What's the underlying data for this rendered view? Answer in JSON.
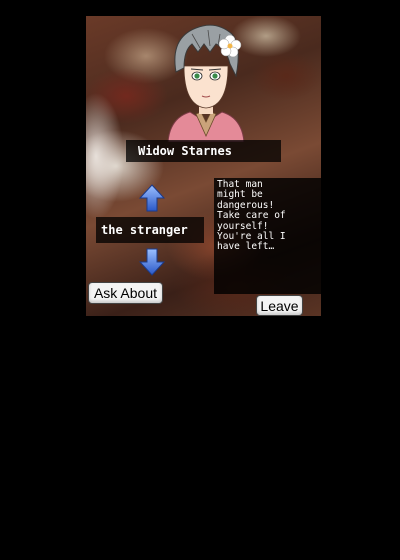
{
  "character": {
    "name": "Widow Starnes",
    "portrait": "widow-starnes-portrait"
  },
  "topic": {
    "label": "the stranger",
    "up_icon": "arrow-up-icon",
    "down_icon": "arrow-down-icon"
  },
  "dialog": {
    "text": "That man\nmight be\ndangerous!\nTake care of\nyourself!\nYou're all I\nhave left…"
  },
  "buttons": {
    "ask_label": "Ask About",
    "leave_label": "Leave"
  },
  "colors": {
    "arrow": "#3f6fd8",
    "panel": "#000000"
  }
}
